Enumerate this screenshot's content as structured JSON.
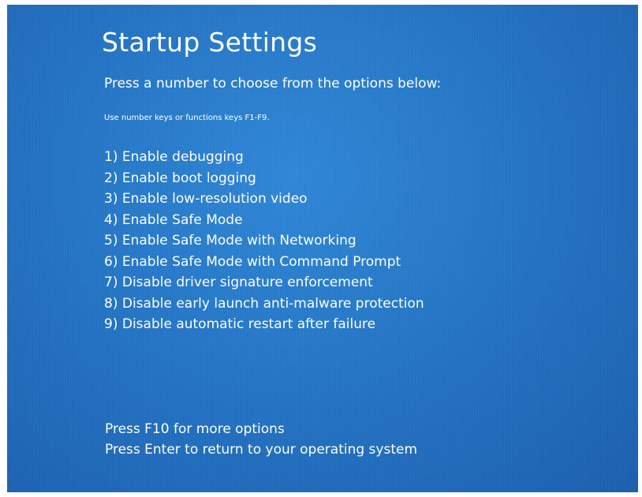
{
  "title": "Startup Settings",
  "subtitle": "Press a number to choose from the options below:",
  "hint": "Use number keys or functions keys F1-F9.",
  "options": [
    "1) Enable debugging",
    "2) Enable boot logging",
    "3) Enable low-resolution video",
    "4) Enable Safe Mode",
    "5) Enable Safe Mode with Networking",
    "6) Enable Safe Mode with Command Prompt",
    "7) Disable driver signature enforcement",
    "8) Disable early launch anti-malware protection",
    "9) Disable automatic restart after failure"
  ],
  "footer": {
    "more_options": "Press F10 for more options",
    "return": "Press Enter to return to your operating system"
  },
  "colors": {
    "background": "#2474c4",
    "text": "#ffffff"
  }
}
